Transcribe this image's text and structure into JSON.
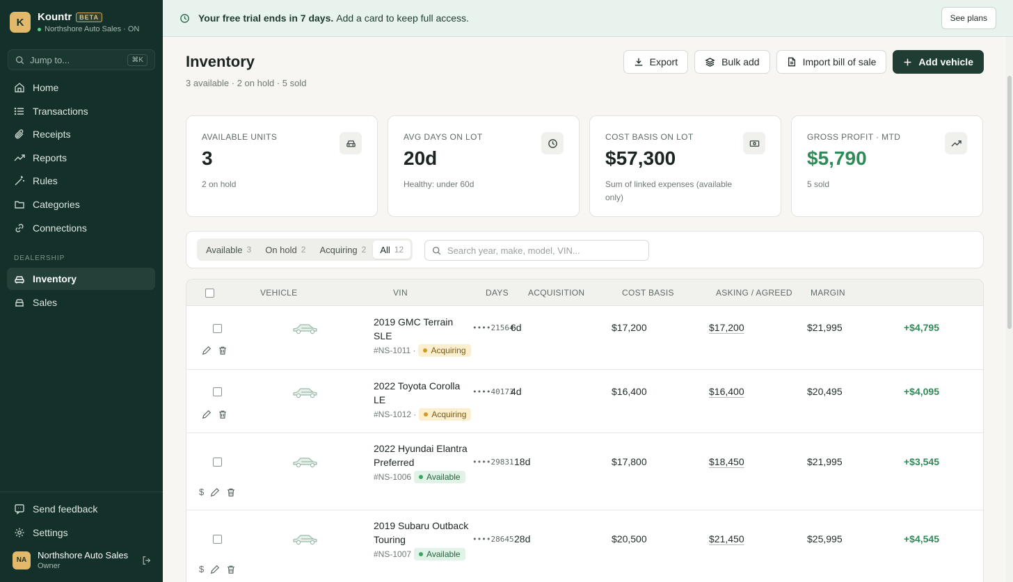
{
  "brand": {
    "logo_letter": "K",
    "name": "Kountr",
    "badge": "BETA",
    "org": "Northshore Auto Sales · ON"
  },
  "jump": {
    "placeholder": "Jump to...",
    "shortcut": "⌘K"
  },
  "nav": {
    "items": [
      {
        "label": "Home",
        "icon": "home-icon"
      },
      {
        "label": "Transactions",
        "icon": "list-icon"
      },
      {
        "label": "Receipts",
        "icon": "paperclip-icon"
      },
      {
        "label": "Reports",
        "icon": "trend-icon"
      },
      {
        "label": "Rules",
        "icon": "wand-icon"
      },
      {
        "label": "Categories",
        "icon": "folder-icon"
      },
      {
        "label": "Connections",
        "icon": "link-icon"
      }
    ],
    "section_label": "DEALERSHIP",
    "dealership_items": [
      {
        "label": "Inventory",
        "icon": "car-icon",
        "active": true
      },
      {
        "label": "Sales",
        "icon": "tag-icon"
      }
    ],
    "bottom_items": [
      {
        "label": "Send feedback",
        "icon": "feedback-icon"
      },
      {
        "label": "Settings",
        "icon": "gear-icon"
      }
    ]
  },
  "user": {
    "initials": "NA",
    "name": "Northshore Auto Sales",
    "role": "Owner"
  },
  "banner": {
    "bold": "Your free trial ends in 7 days.",
    "text": "Add a card to keep full access.",
    "button": "See plans"
  },
  "page": {
    "title": "Inventory",
    "subtitle": "3 available · 2 on hold · 5 sold"
  },
  "actions": {
    "export": "Export",
    "bulk_add": "Bulk add",
    "import": "Import bill of sale",
    "add": "Add vehicle"
  },
  "cards": [
    {
      "label": "AVAILABLE UNITS",
      "value": "3",
      "note": "2 on hold",
      "icon": "car-icon"
    },
    {
      "label": "AVG DAYS ON LOT",
      "value": "20d",
      "note": "Healthy: under 60d",
      "icon": "clock-icon"
    },
    {
      "label": "COST BASIS ON LOT",
      "value": "$57,300",
      "note": "Sum of linked expenses (available only)",
      "icon": "cash-icon"
    },
    {
      "label": "GROSS PROFIT · MTD",
      "value": "$5,790",
      "note": "5 sold",
      "icon": "trend-up-icon"
    }
  ],
  "tabs": [
    {
      "label": "Available",
      "count": "3"
    },
    {
      "label": "On hold",
      "count": "2"
    },
    {
      "label": "Acquiring",
      "count": "2"
    },
    {
      "label": "All",
      "count": "12",
      "active": true
    }
  ],
  "search": {
    "placeholder": "Search year, make, model, VIN..."
  },
  "table": {
    "headers": {
      "vehicle": "VEHICLE",
      "vin": "VIN",
      "days": "DAYS",
      "acquisition": "ACQUISITION",
      "cost_basis": "COST BASIS",
      "asking": "ASKING / AGREED",
      "margin": "MARGIN"
    },
    "rows": [
      {
        "title": "2019 GMC Terrain SLE",
        "stock": "#NS-1011 ·",
        "status": "Acquiring",
        "vin": "••••21564",
        "days": "6d",
        "acquisition": "$17,200",
        "cost_basis": "$17,200",
        "asking": "$21,995",
        "margin": "+$4,795"
      },
      {
        "title": "2022 Toyota Corolla LE",
        "stock": "#NS-1012 ·",
        "status": "Acquiring",
        "vin": "••••40173",
        "days": "4d",
        "acquisition": "$16,400",
        "cost_basis": "$16,400",
        "asking": "$20,495",
        "margin": "+$4,095"
      },
      {
        "title": "2022 Hyundai Elantra Preferred",
        "stock": "#NS-1006",
        "status": "Available",
        "vin": "••••29831",
        "days": "18d",
        "acquisition": "$17,800",
        "cost_basis": "$18,450",
        "asking": "$21,995",
        "margin": "+$3,545"
      },
      {
        "title": "2019 Subaru Outback Touring",
        "stock": "#NS-1007",
        "status": "Available",
        "vin": "••••28645",
        "days": "28d",
        "acquisition": "$20,500",
        "cost_basis": "$21,450",
        "asking": "$25,995",
        "margin": "+$4,545"
      }
    ]
  },
  "colors": {
    "sidebar": "#14302a",
    "accent": "#1f3d33",
    "positive": "#2f8a57",
    "acquiring": "#d19a24",
    "available": "#37a663"
  }
}
